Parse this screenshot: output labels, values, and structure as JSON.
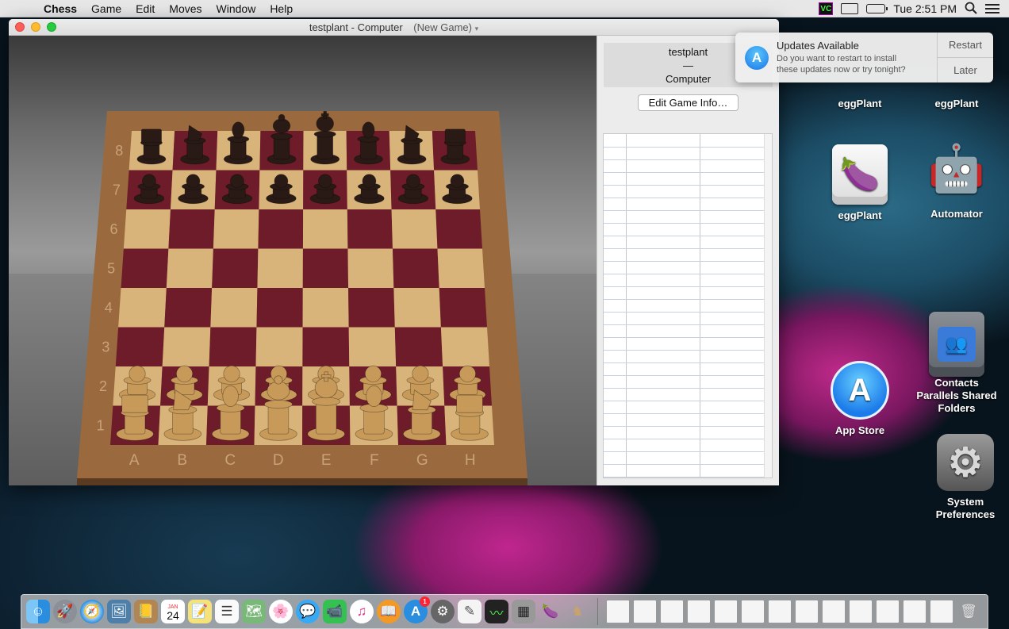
{
  "menubar": {
    "apple": "",
    "app_name": "Chess",
    "menus": [
      "Game",
      "Edit",
      "Moves",
      "Window",
      "Help"
    ],
    "clock": "Tue 2:51 PM",
    "vnc_label": "VC"
  },
  "window": {
    "title": "testplant - Computer",
    "document_state": "(New Game)"
  },
  "board": {
    "rank_labels": [
      "8",
      "7",
      "6",
      "5",
      "4",
      "3",
      "2",
      "1"
    ],
    "file_labels": [
      "A",
      "B",
      "C",
      "D",
      "E",
      "F",
      "G",
      "H"
    ],
    "back_rank": [
      "rook",
      "knight",
      "bishop",
      "queen",
      "king",
      "bishop",
      "knight",
      "rook"
    ],
    "colors": {
      "light_square": "#d9b47a",
      "dark_square": "#6e1c2a",
      "frame": "#9a6a3e",
      "black_piece": "#2a1a16",
      "white_piece": "#c89a5a"
    }
  },
  "panel": {
    "white_player": "testplant",
    "separator": "—",
    "black_player": "Computer",
    "edit_button": "Edit Game Info…",
    "move_rows": 27
  },
  "notification": {
    "title": "Updates Available",
    "body_line1": "Do you want to restart to install",
    "body_line2": "these updates now or try tonight?",
    "restart": "Restart",
    "later": "Later",
    "icon": "app-store-icon"
  },
  "desktop_icons": [
    {
      "name": "eggPlant",
      "icon": "eggplant-icon"
    },
    {
      "name": "eggPlant",
      "icon": "eggplant-icon"
    },
    {
      "name": "eggPlant",
      "icon": "eggplant-drive-icon"
    },
    {
      "name": "Automator",
      "icon": "automator-robot-icon"
    },
    {
      "name": "Contacts",
      "icon": "contacts-icon"
    },
    {
      "name": "Parallels Shared Folders",
      "icon": "parallels-shared-folders-icon"
    },
    {
      "name": "App Store",
      "icon": "app-store-icon"
    },
    {
      "name": "System Preferences",
      "icon": "system-preferences-icon"
    }
  ],
  "dock": {
    "calendar_month": "JAN",
    "calendar_day": "24",
    "appstore_badge": "1",
    "apps": [
      "finder",
      "launchpad",
      "safari",
      "preview",
      "contacts-book",
      "calendar",
      "notes",
      "reminders",
      "maps",
      "photos",
      "messages",
      "facetime",
      "itunes",
      "ibooks",
      "app-store",
      "system-preferences",
      "textedit",
      "activity-monitor",
      "calculator",
      "eggplant",
      "chess"
    ]
  }
}
